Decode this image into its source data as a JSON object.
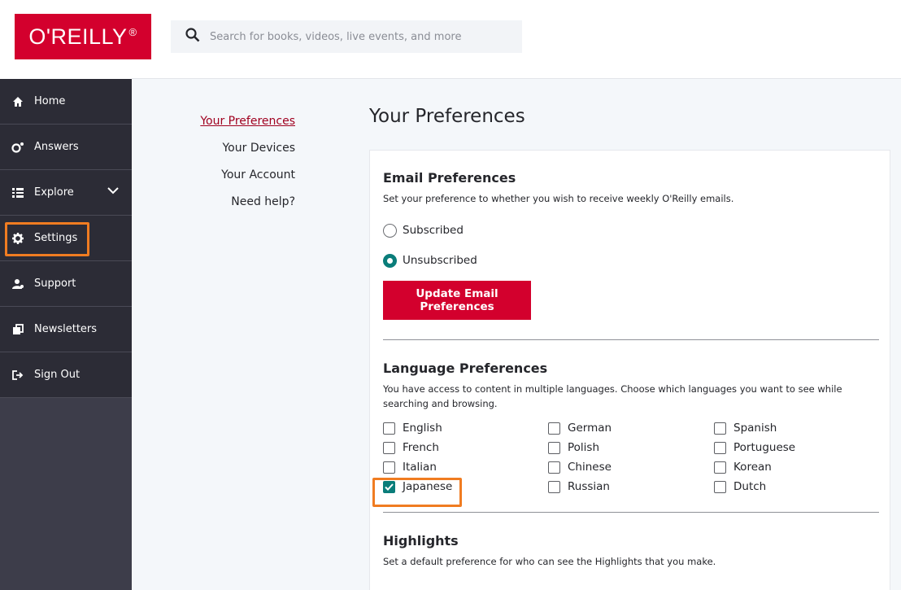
{
  "brand": {
    "logo_text": "O'REILLY",
    "logo_mark": "®",
    "color": "#d3002d"
  },
  "search": {
    "placeholder": "Search for books, videos, live events, and more",
    "value": ""
  },
  "sidebar": {
    "items": [
      {
        "label": "Home",
        "icon": "home-icon"
      },
      {
        "label": "Answers",
        "icon": "answers-icon"
      },
      {
        "label": "Explore",
        "icon": "explore-icon"
      },
      {
        "label": "Settings",
        "icon": "gear-icon"
      },
      {
        "label": "Support",
        "icon": "support-icon"
      },
      {
        "label": "Newsletters",
        "icon": "newsletters-icon"
      },
      {
        "label": "Sign Out",
        "icon": "sign-out-icon"
      }
    ]
  },
  "subnav": {
    "items": [
      {
        "label": "Your Preferences",
        "active": true
      },
      {
        "label": "Your Devices"
      },
      {
        "label": "Your Account"
      },
      {
        "label": "Need help?"
      }
    ]
  },
  "main": {
    "title": "Your Preferences",
    "email": {
      "title": "Email Preferences",
      "desc": "Set your preference to whether you wish to receive weekly O'Reilly emails.",
      "options": [
        {
          "label": "Subscribed",
          "checked": false
        },
        {
          "label": "Unsubscribed",
          "checked": true
        }
      ],
      "button": "Update Email Preferences"
    },
    "language": {
      "title": "Language Preferences",
      "desc": "You have access to content in multiple languages. Choose which languages you want to see while searching and browsing.",
      "options": [
        {
          "label": "English",
          "checked": false
        },
        {
          "label": "German",
          "checked": false
        },
        {
          "label": "Spanish",
          "checked": false
        },
        {
          "label": "French",
          "checked": false
        },
        {
          "label": "Polish",
          "checked": false
        },
        {
          "label": "Portuguese",
          "checked": false
        },
        {
          "label": "Italian",
          "checked": false
        },
        {
          "label": "Chinese",
          "checked": false
        },
        {
          "label": "Korean",
          "checked": false
        },
        {
          "label": "Japanese",
          "checked": true
        },
        {
          "label": "Russian",
          "checked": false
        },
        {
          "label": "Dutch",
          "checked": false
        }
      ]
    },
    "highlights": {
      "title": "Highlights",
      "desc": "Set a default preference for who can see the Highlights that you make."
    }
  },
  "colors": {
    "accent": "#d3002d",
    "check": "#0a7d7a",
    "callout": "#f07c21",
    "sidebar": "#2c2c36"
  }
}
